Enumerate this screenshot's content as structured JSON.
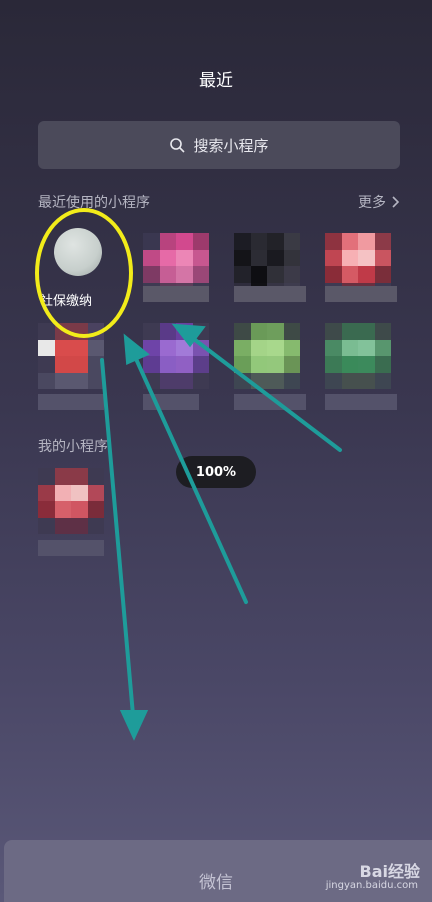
{
  "header": {
    "title": "最近"
  },
  "search": {
    "placeholder": "搜索小程序",
    "icon": "search-icon"
  },
  "recent": {
    "label": "最近使用的小程序",
    "more_label": "更多",
    "items": [
      {
        "label": "社保缴纳"
      },
      {
        "label": ""
      },
      {
        "label": ""
      },
      {
        "label": ""
      },
      {
        "label": ""
      },
      {
        "label": ""
      },
      {
        "label": ""
      },
      {
        "label": ""
      }
    ]
  },
  "mine": {
    "label": "我的小程序"
  },
  "zoom": {
    "percent": "100%"
  },
  "tabbar": {
    "label": "微信"
  },
  "watermark": {
    "brand": "Bai经验",
    "url": "jingyan.baidu.com"
  },
  "colors": {
    "highlight": "#f2ec1a",
    "arrow": "#1e9c9a"
  }
}
